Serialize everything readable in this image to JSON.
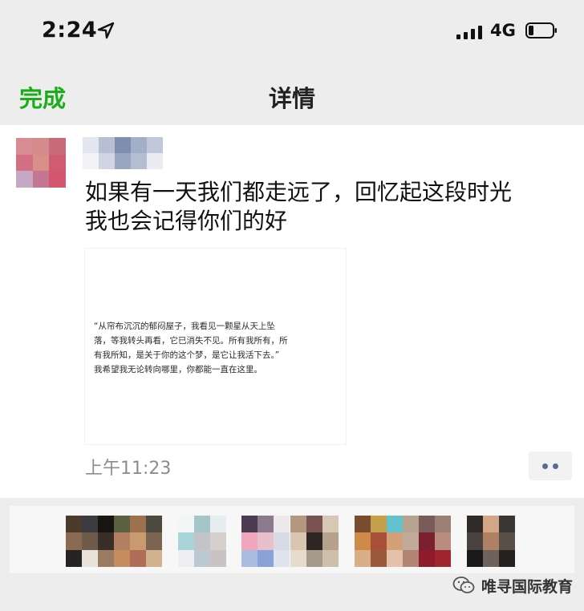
{
  "status": {
    "time": "2:24",
    "network": "4G"
  },
  "nav": {
    "done_label": "完成",
    "title": "详情"
  },
  "post": {
    "text_lines": [
      "如果有一天我们都走远了，回忆起这段时光",
      "我也会记得你们的好"
    ],
    "quote_lines": [
      "“从帘布沉沉的郁闷屋子，我看见一颗星从天上坠",
      "落，等我转头再看，它已消失不见。所有我所有，所",
      "有我所知，是关于你的这个梦，是它让我活下去。”",
      "我希望我无论转向哪里，你都能一直在这里。"
    ],
    "timestamp": "上午11:23"
  },
  "watermark": {
    "text": "唯寻国际教育"
  },
  "colors": {
    "accent_green": "#1aad19",
    "link_blue": "#576b95",
    "background": "#ededed",
    "card": "#ffffff"
  },
  "icons": [
    "location-arrow-icon",
    "signal-icon",
    "battery-icon",
    "more-icon",
    "wechat-logo-icon"
  ]
}
